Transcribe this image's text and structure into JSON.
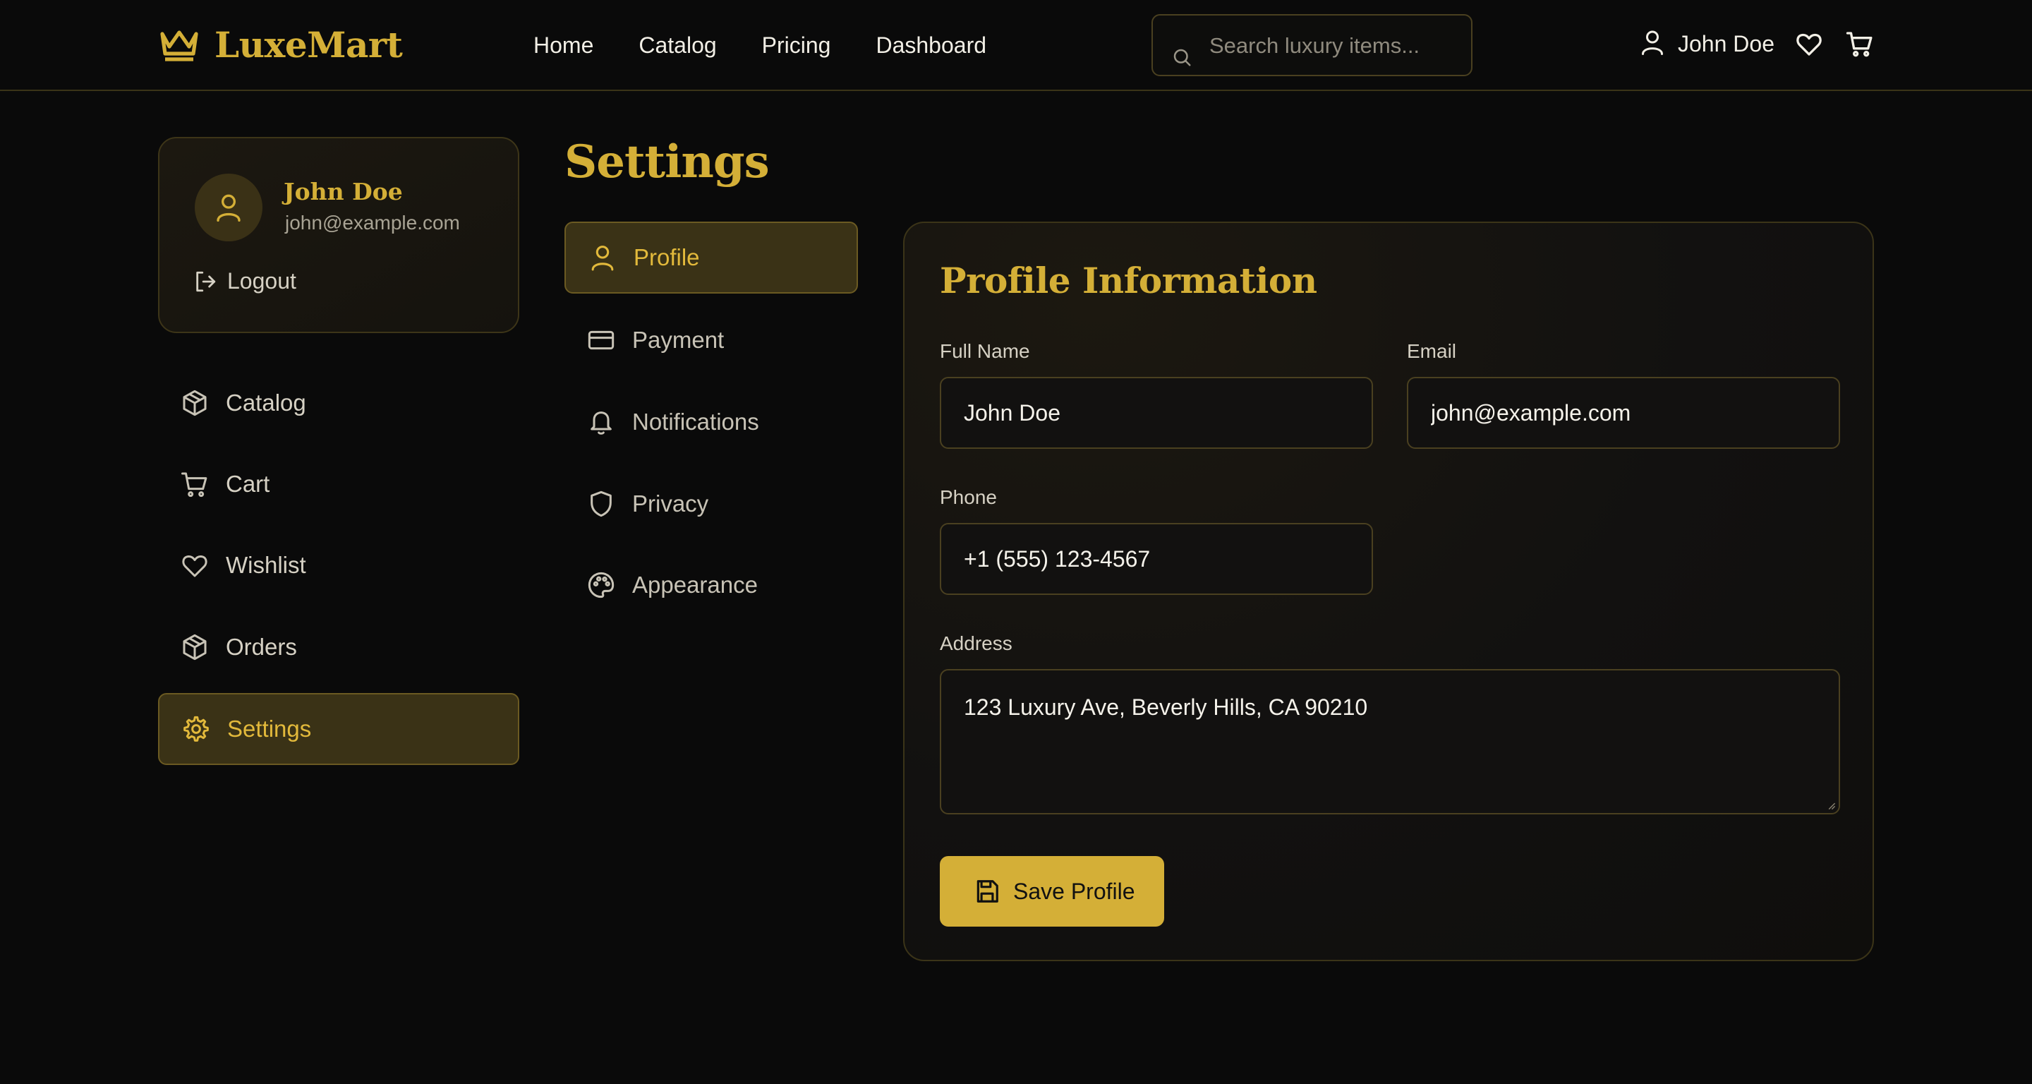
{
  "brand": {
    "name": "LuxeMart",
    "accent": "#d4af37",
    "icon": "crown-icon"
  },
  "nav": [
    {
      "label": "Home"
    },
    {
      "label": "Catalog"
    },
    {
      "label": "Pricing"
    },
    {
      "label": "Dashboard"
    }
  ],
  "search": {
    "placeholder": "Search luxury items...",
    "value": "",
    "icon": "search-icon"
  },
  "header_user": {
    "name": "John Doe",
    "icons": [
      "user-icon",
      "heart-icon",
      "cart-icon"
    ]
  },
  "profile_card": {
    "name": "John Doe",
    "email": "john@example.com",
    "logout_label": "Logout"
  },
  "sidebar": {
    "items": [
      {
        "label": "Catalog",
        "icon": "box-icon"
      },
      {
        "label": "Cart",
        "icon": "cart-icon"
      },
      {
        "label": "Wishlist",
        "icon": "heart-icon"
      },
      {
        "label": "Orders",
        "icon": "box-icon"
      },
      {
        "label": "Settings",
        "icon": "gear-icon",
        "active": true
      }
    ]
  },
  "settings": {
    "title": "Settings",
    "menu": [
      {
        "label": "Profile",
        "icon": "user-icon",
        "active": true
      },
      {
        "label": "Payment",
        "icon": "credit-card-icon"
      },
      {
        "label": "Notifications",
        "icon": "bell-icon"
      },
      {
        "label": "Privacy",
        "icon": "shield-icon"
      },
      {
        "label": "Appearance",
        "icon": "palette-icon"
      }
    ]
  },
  "profile_form": {
    "title": "Profile Information",
    "full_name": {
      "label": "Full Name",
      "value": "John Doe"
    },
    "email": {
      "label": "Email",
      "value": "john@example.com"
    },
    "phone": {
      "label": "Phone",
      "value": "+1 (555) 123-4567"
    },
    "address": {
      "label": "Address",
      "value": "123 Luxury Ave, Beverly Hills, CA 90210"
    },
    "save_label": "Save Profile"
  },
  "colors": {
    "background": "#0a0a0a",
    "accent": "#d4af37",
    "active_bg": "#3a3216"
  }
}
